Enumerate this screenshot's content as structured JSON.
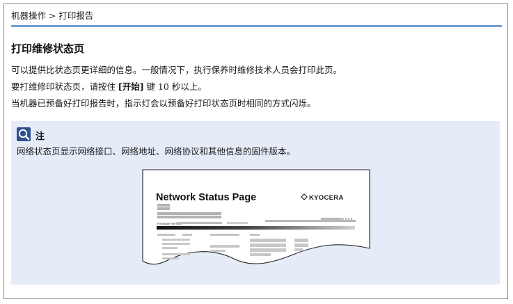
{
  "breadcrumb": "机器操作 > 打印报告",
  "section_title": "打印维修状态页",
  "paragraphs": {
    "p1": "可以提供比状态页更详细的信息。一般情况下，执行保养时维修技术人员会打印此页。",
    "p2_before": "要打维修印状态页，请按住 ",
    "p2_key": "[开始]",
    "p2_after": " 键 10 秒以上。",
    "p3": "当机器已预备好打印报告时，指示灯会以预备好打印状态页时相同的方式闪烁。"
  },
  "note": {
    "icon": "note-icon",
    "title": "注",
    "text": "网络状态页显示网络接口、网络地址、网络协议和其他信息的固件版本。"
  },
  "illustration": {
    "page_title": "Network Status Page",
    "brand": "KYOCERA",
    "firmware_label": "Firmware Version"
  },
  "colors": {
    "accent_rule": "#6f9fd8",
    "note_background": "#e5ecf8"
  }
}
